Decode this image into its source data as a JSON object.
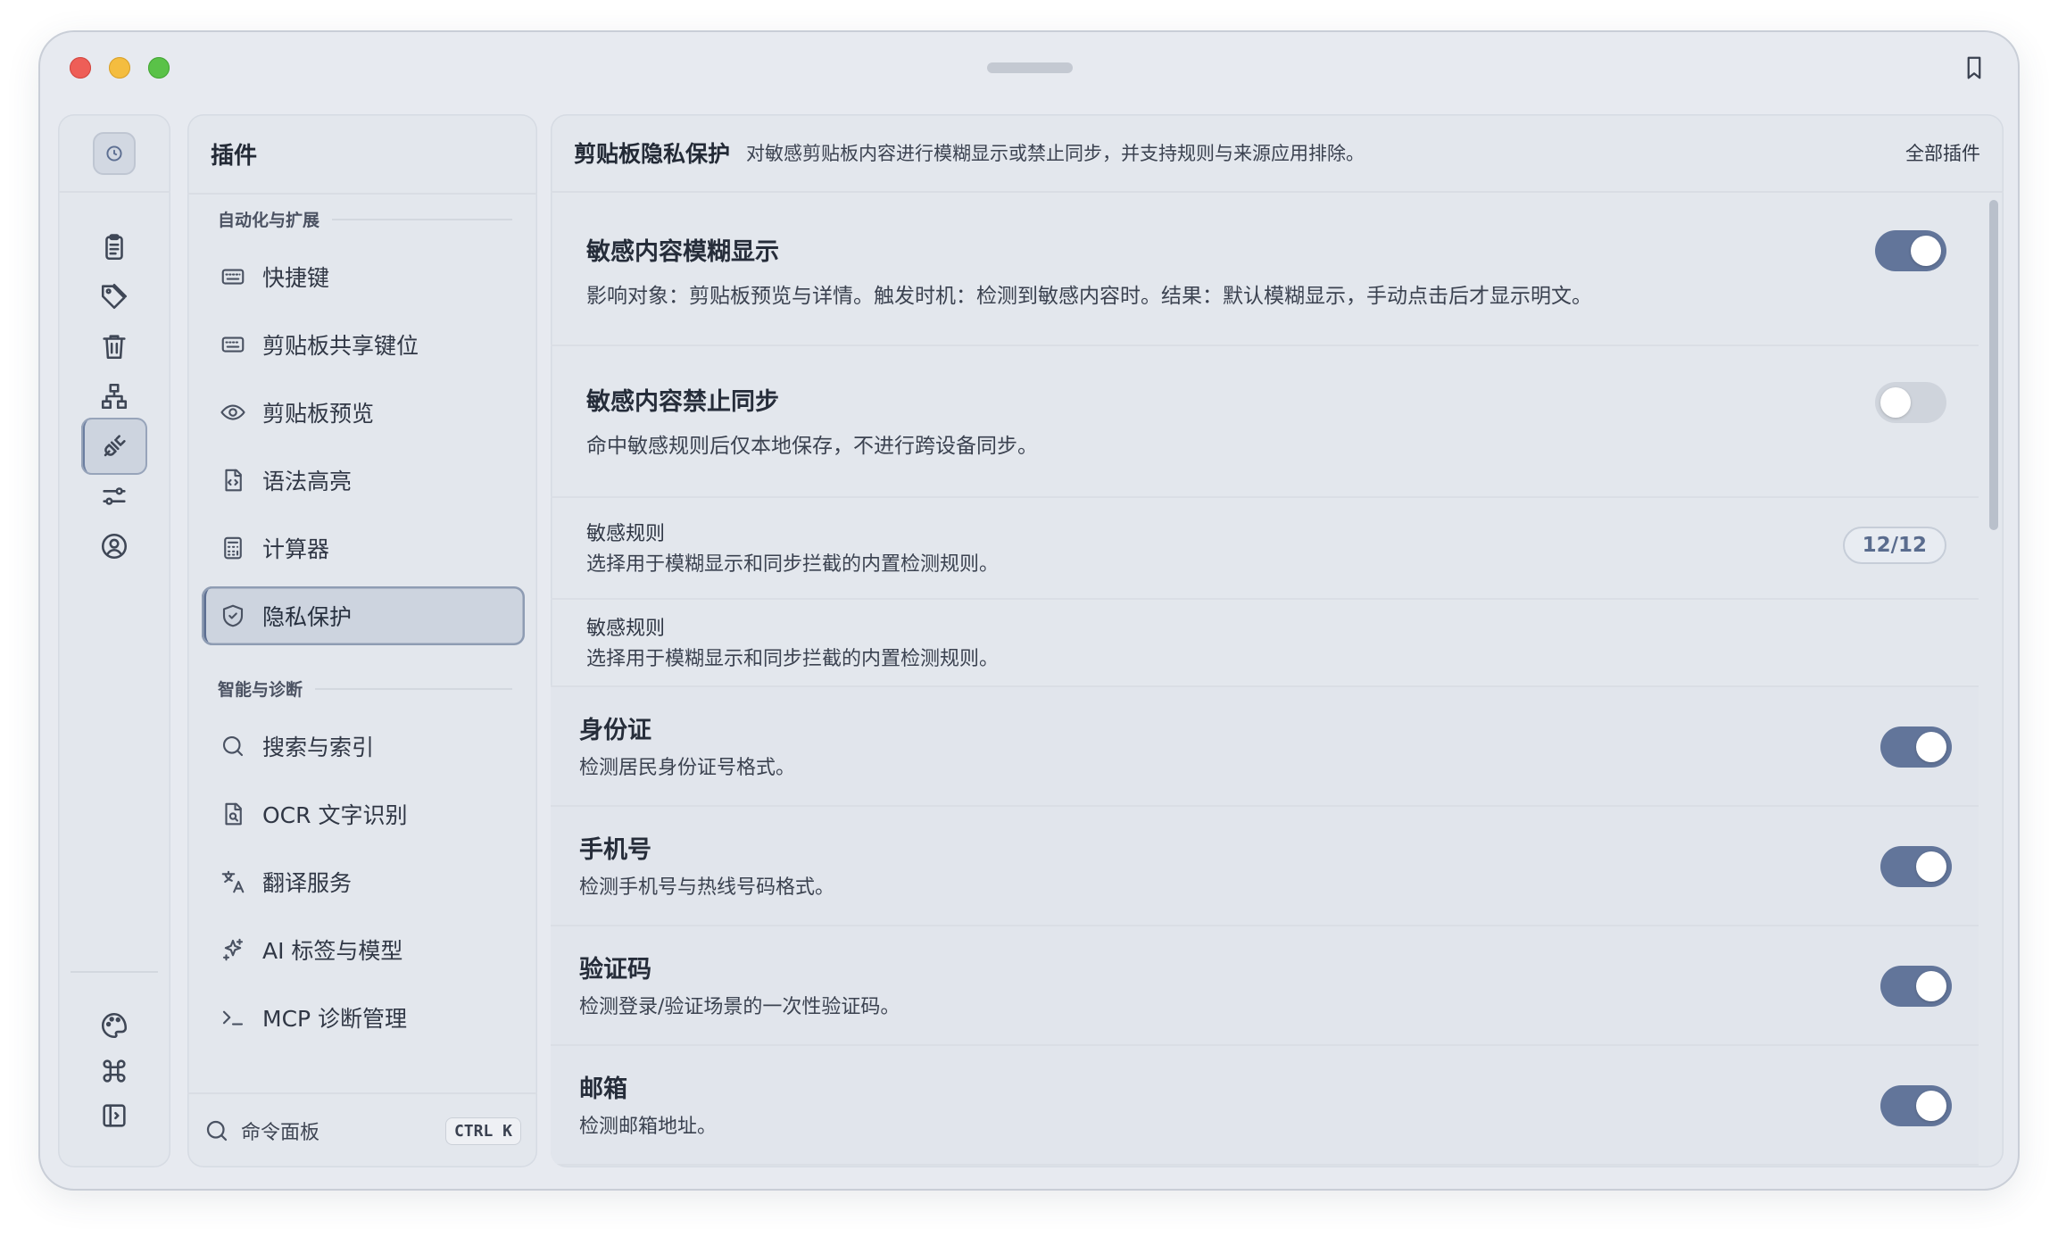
{
  "rail": {
    "items": [
      {
        "name": "clipboard",
        "icon": "clipboard-icon"
      },
      {
        "name": "tags",
        "icon": "tag-icon"
      },
      {
        "name": "trash",
        "icon": "trash-icon"
      },
      {
        "name": "network",
        "icon": "network-icon"
      },
      {
        "name": "plugins",
        "icon": "plug-icon",
        "active": true
      },
      {
        "name": "settings",
        "icon": "sliders-icon"
      },
      {
        "name": "account",
        "icon": "user-circle-icon"
      }
    ],
    "bottom": [
      {
        "name": "theme",
        "icon": "palette-icon"
      },
      {
        "name": "shortcuts",
        "icon": "command-icon"
      },
      {
        "name": "sidebar",
        "icon": "sidebar-toggle-icon"
      }
    ]
  },
  "plugins": {
    "title": "插件",
    "sections": [
      {
        "label": "自动化与扩展",
        "items": [
          {
            "label": "快捷键",
            "icon": "keyboard-icon"
          },
          {
            "label": "剪贴板共享键位",
            "icon": "keyboard-icon"
          },
          {
            "label": "剪贴板预览",
            "icon": "eye-icon"
          },
          {
            "label": "语法高亮",
            "icon": "code-file-icon"
          },
          {
            "label": "计算器",
            "icon": "calculator-icon"
          },
          {
            "label": "隐私保护",
            "icon": "shield-check-icon",
            "active": true
          }
        ]
      },
      {
        "label": "智能与诊断",
        "items": [
          {
            "label": "搜索与索引",
            "icon": "search-icon"
          },
          {
            "label": "OCR 文字识别",
            "icon": "ocr-file-icon"
          },
          {
            "label": "翻译服务",
            "icon": "translate-icon"
          },
          {
            "label": "AI 标签与模型",
            "icon": "sparkles-icon"
          },
          {
            "label": "MCP 诊断管理",
            "icon": "terminal-icon"
          }
        ]
      }
    ],
    "footer": {
      "label": "命令面板",
      "shortcut": "CTRL K"
    }
  },
  "main": {
    "title": "剪贴板隐私保护",
    "description": "对敏感剪贴板内容进行模糊显示或禁止同步，并支持规则与来源应用排除。",
    "link": "全部插件",
    "settings": [
      {
        "title": "敏感内容模糊显示",
        "description": "影响对象：剪贴板预览与详情。触发时机：检测到敏感内容时。结果：默认模糊显示，手动点击后才显示明文。",
        "enabled": true
      },
      {
        "title": "敏感内容禁止同步",
        "description": "命中敏感规则后仅本地保存，不进行跨设备同步。",
        "enabled": false
      }
    ],
    "rules_summary": {
      "title": "敏感规则",
      "description": "选择用于模糊显示和同步拦截的内置检测规则。",
      "count": "12/12"
    },
    "rules_header": {
      "title": "敏感规则",
      "description": "选择用于模糊显示和同步拦截的内置检测规则。"
    },
    "rules": [
      {
        "title": "身份证",
        "description": "检测居民身份证号格式。",
        "enabled": true
      },
      {
        "title": "手机号",
        "description": "检测手机号与热线号码格式。",
        "enabled": true
      },
      {
        "title": "验证码",
        "description": "检测登录/验证场景的一次性验证码。",
        "enabled": true
      },
      {
        "title": "邮箱",
        "description": "检测邮箱地址。",
        "enabled": true
      }
    ]
  },
  "colors": {
    "accent": "#62759a",
    "toggle_off": "#cfd4dc",
    "window_bg": "#e7eaf0"
  }
}
